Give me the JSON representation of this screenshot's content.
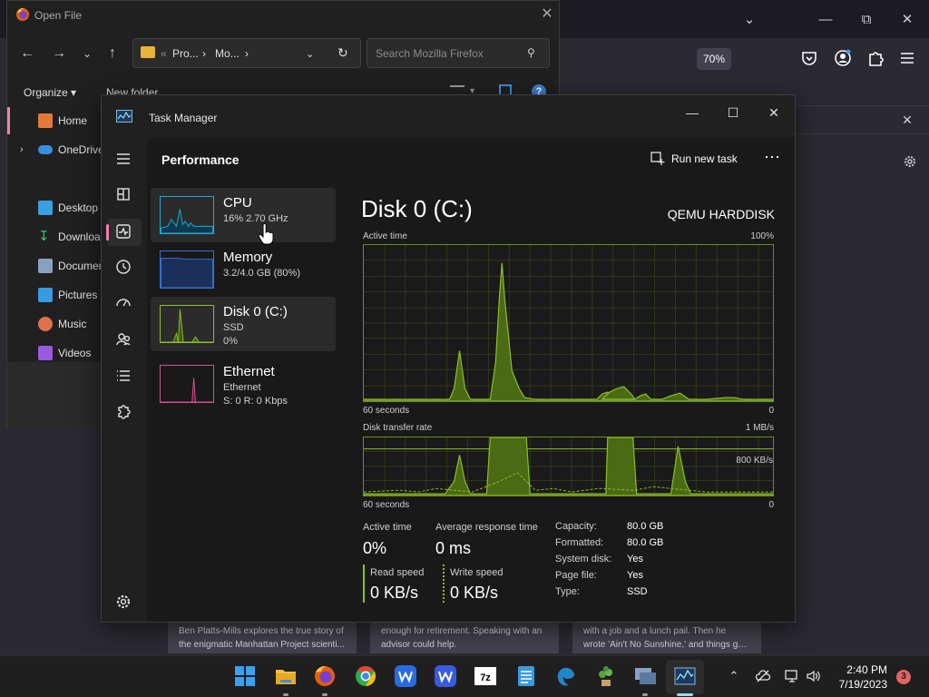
{
  "firefox": {
    "zoom": "70%",
    "news": [
      {
        "line1": "Ben Platts-Mills explores the true story of",
        "line2": "the enigmatic Manhattan Project scienti..."
      },
      {
        "line1": "enough for retirement. Speaking with an",
        "line2": "advisor could help."
      },
      {
        "line1": "with a job and a lunch pail. Then he",
        "line2": "wrote 'Ain't No Sunshine,' and things go..."
      }
    ]
  },
  "open_file": {
    "title": "Open File",
    "crumbs": [
      "Pro...",
      "Mo..."
    ],
    "search_placeholder": "Search Mozilla Firefox",
    "organize": "Organize",
    "new_folder": "New folder",
    "sidebar": [
      {
        "label": "Home",
        "color": "#e07a3a"
      },
      {
        "label": "OneDrive",
        "color": "#3a8ee0"
      },
      {
        "label": "Desktop",
        "color": "#3aa0e0"
      },
      {
        "label": "Downloads",
        "color": "#3ac07a"
      },
      {
        "label": "Documents",
        "color": "#8aa0c0"
      },
      {
        "label": "Pictures",
        "color": "#3a9ae0"
      },
      {
        "label": "Music",
        "color": "#e07050"
      },
      {
        "label": "Videos",
        "color": "#9a5ae0"
      }
    ]
  },
  "task_manager": {
    "title": "Task Manager",
    "header": "Performance",
    "run_new_task": "Run new task",
    "items": [
      {
        "name": "CPU",
        "line1": "16%  2.70 GHz",
        "line2": "",
        "color": "#1fa8d8"
      },
      {
        "name": "Memory",
        "line1": "3.2/4.0 GB (80%)",
        "line2": "",
        "color": "#3d6fd0"
      },
      {
        "name": "Disk 0 (C:)",
        "line1": "SSD",
        "line2": "0%",
        "color": "#8fbd2a"
      },
      {
        "name": "Ethernet",
        "line1": "Ethernet",
        "line2": "S: 0  R: 0 Kbps",
        "color": "#d44f8e"
      }
    ],
    "disk": {
      "title": "Disk 0 (C:)",
      "model": "QEMU HARDDISK",
      "active_time_label": "Active time",
      "active_time_max": "100%",
      "seconds_label": "60 seconds",
      "zero": "0",
      "transfer_label": "Disk transfer rate",
      "transfer_max": "1 MB/s",
      "transfer_line": "800 KB/s",
      "stats": {
        "active_time": {
          "label": "Active time",
          "value": "0%"
        },
        "avg_response": {
          "label": "Average response time",
          "value": "0 ms"
        },
        "read_speed": {
          "label": "Read speed",
          "value": "0 KB/s"
        },
        "write_speed": {
          "label": "Write speed",
          "value": "0 KB/s"
        }
      },
      "properties": [
        {
          "label": "Capacity:",
          "value": "80.0 GB"
        },
        {
          "label": "Formatted:",
          "value": "80.0 GB"
        },
        {
          "label": "System disk:",
          "value": "Yes"
        },
        {
          "label": "Page file:",
          "value": "Yes"
        },
        {
          "label": "Type:",
          "value": "SSD"
        }
      ]
    },
    "accent": "#8fbd2a"
  },
  "taskbar": {
    "time": "2:40 PM",
    "date": "7/19/2023",
    "badge": "3"
  }
}
